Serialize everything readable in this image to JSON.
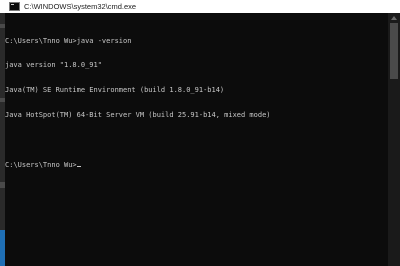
{
  "window": {
    "title": "C:\\WINDOWS\\system32\\cmd.exe",
    "icon": "cmd-icon"
  },
  "console": {
    "lines": [
      "C:\\Users\\Tnno Wu>java -version",
      "java version \"1.8.0_91\"",
      "Java(TM) SE Runtime Environment (build 1.8.0_91-b14)",
      "Java HotSpot(TM) 64-Bit Server VM (build 25.91-b14, mixed mode)",
      "",
      "C:\\Users\\Tnno Wu>"
    ]
  }
}
